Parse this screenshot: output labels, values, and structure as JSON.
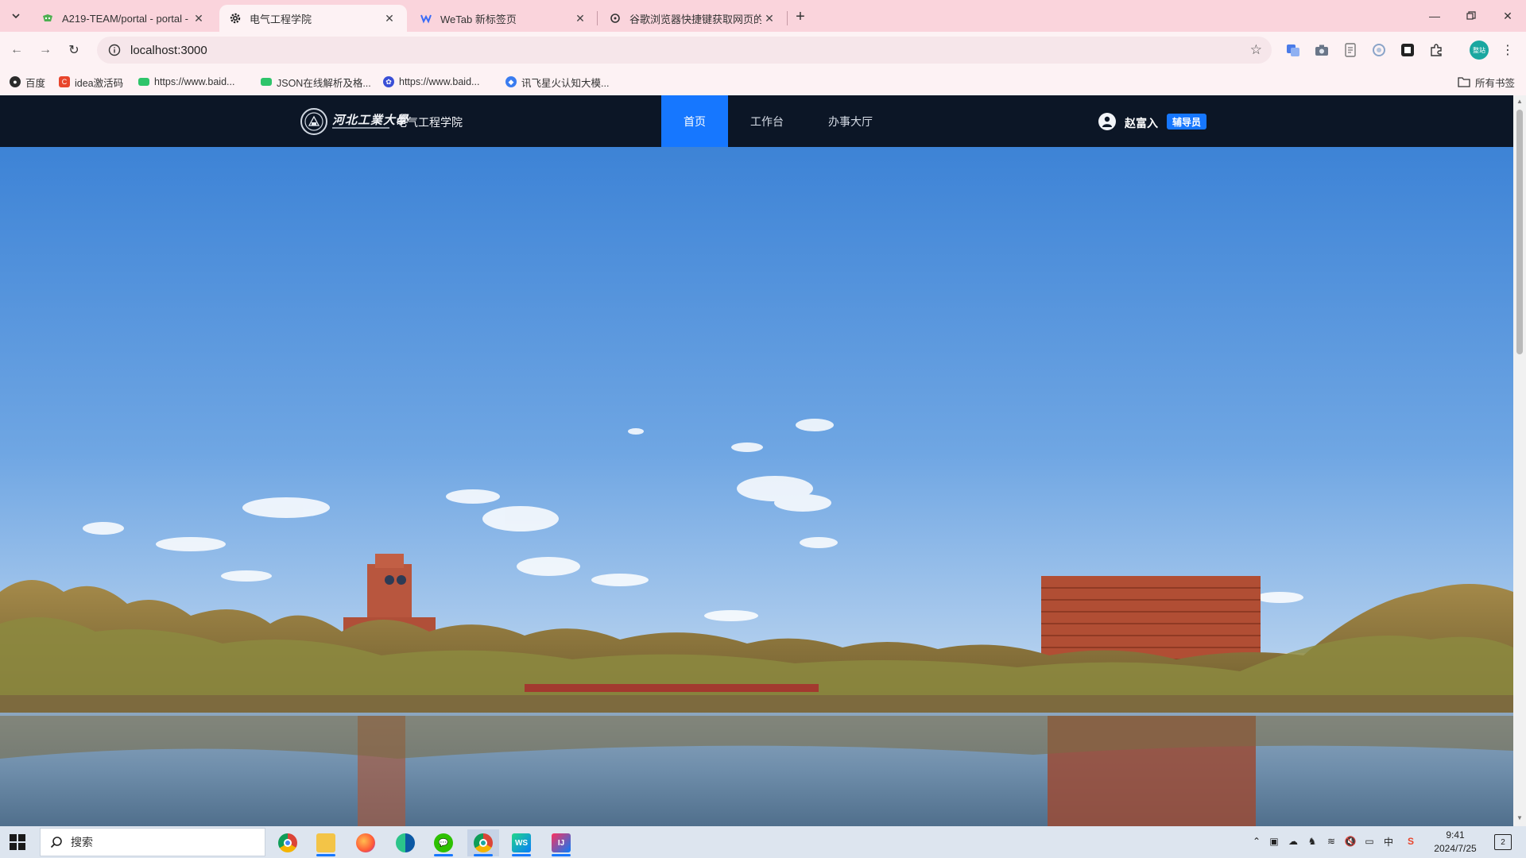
{
  "browser": {
    "tabs": [
      {
        "title": "A219-TEAM/portal - portal -",
        "active": false,
        "icon": "gitee-icon"
      },
      {
        "title": "电气工程学院",
        "active": true,
        "icon": "gear-icon"
      },
      {
        "title": "WeTab 新标签页",
        "active": false,
        "icon": "wetab-icon"
      },
      {
        "title": "谷歌浏览器快捷键获取网页的所",
        "active": false,
        "icon": "link-icon"
      }
    ],
    "url": "localhost:3000",
    "bookmarks": [
      {
        "label": "百度"
      },
      {
        "label": "idea激活码"
      },
      {
        "label": "https://www.baid..."
      },
      {
        "label": "JSON在线解析及格..."
      },
      {
        "label": "https://www.baid..."
      },
      {
        "label": "讯飞星火认知大模..."
      }
    ],
    "all_bookmarks": "所有书签",
    "profile_initials": "整站"
  },
  "site": {
    "logo_calligraphy": "河北工業大學",
    "college_name": "电气工程学院",
    "nav": [
      {
        "label": "首页",
        "active": true
      },
      {
        "label": "工作台",
        "active": false
      },
      {
        "label": "办事大厅",
        "active": false
      }
    ],
    "user_name": "赵富入",
    "user_role": "辅导员"
  },
  "taskbar": {
    "search_placeholder": "搜索",
    "time": "9:41",
    "date": "2024/7/25",
    "notification_count": "2"
  },
  "colors": {
    "header_bg": "#0c1626",
    "accent": "#1677ff",
    "tabstrip": "#fad4dc"
  }
}
